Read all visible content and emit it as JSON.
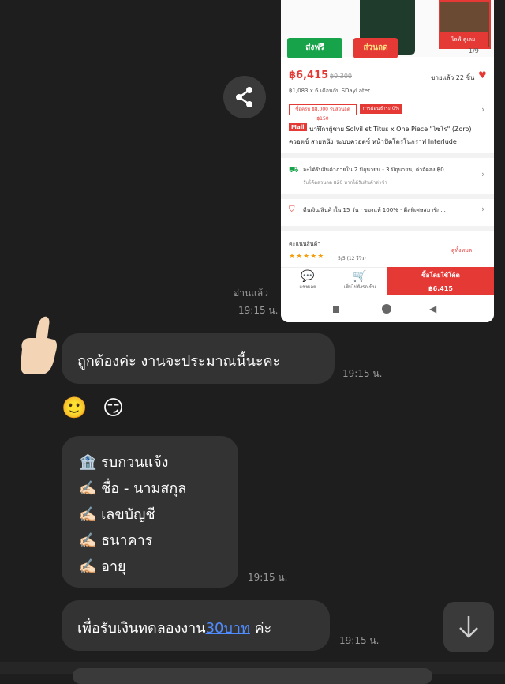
{
  "shared_card": {
    "free_badge": "ส่งฟรี",
    "sale_badge": "ส่วนลด",
    "thumb_caption": "ไลฟ์ ดูเลย",
    "page_counter": "1/9",
    "price": "฿6,415",
    "old_price": "฿9,300",
    "sold_count": "ขายแล้ว 22 ชิ้น",
    "installment": "฿1,083 x 6 เดือนกับ SDayLater",
    "coupon_shipping": "ซื้อครบ ฿8,000 รับส่วนลด ฿150",
    "coupon_discount": "การผ่อนชำระ 0%",
    "mall_tag": "Mall",
    "product_title": "นาฬิกาผู้ชาย Solvil et Titus x One Piece \"โซโร\" (Zoro) ควอตซ์ สายหนัง ระบบควอตซ์ หน้าปัดโครโนกราฟ Interlude",
    "shipping_line": "จะได้รับสินค้าภายใน 2 มิถุนายน - 3 มิถุนายน, ค่าจัดส่ง ฿0",
    "shipping_sub": "รับโค้ดส่วนลด ฿20 หากได้รับสินค้าล่าช้า",
    "return_line": "คืนเงิน/สินค้าใน 15 วัน · ของแท้ 100% · ดีลพิเศษสมาชิก...",
    "review_header": "คะแนนสินค้า",
    "review_all": "ดูทั้งหมด",
    "stars": "★★★★★",
    "rating": "5/5 (12 รีวิว)",
    "chat_label": "แชทเลย",
    "cart_label": "เพิ่มไปยังรถเข็น",
    "buy_label": "ซื้อโดยใช้โค้ด",
    "buy_price": "฿6,415"
  },
  "chat": {
    "read_label": "อ่านแล้ว",
    "msg1_time": "19:15 น.",
    "msg2_text": "ถูกต้องค่ะ งานจะประมาณนี้นะคะ",
    "msg2_time": "19:15 น.",
    "emoji_smile": "🙂",
    "emoji_wink": "😏",
    "msg3_lines": [
      "🏦 รบกวนแจ้ง",
      "✍🏻 ชื่อ - นามสกุล",
      "✍🏻 เลขบัญชี",
      "✍🏻 ธนาคาร",
      "✍🏻 อายุ"
    ],
    "msg3_time": "19:15 น.",
    "msg4_prefix": "เพื่อรับเงินทดลองงาน",
    "msg4_highlight": "30บาท",
    "msg4_suffix": " ค่ะ",
    "msg4_time": "19:15 น."
  },
  "colors": {
    "background": "#1e1e1e",
    "bubble": "#333333",
    "accent_red": "#e53935",
    "link_blue": "#4f8cff"
  },
  "icons": [
    "share-icon",
    "scroll-down-icon",
    "thumbs-up-avatar"
  ]
}
